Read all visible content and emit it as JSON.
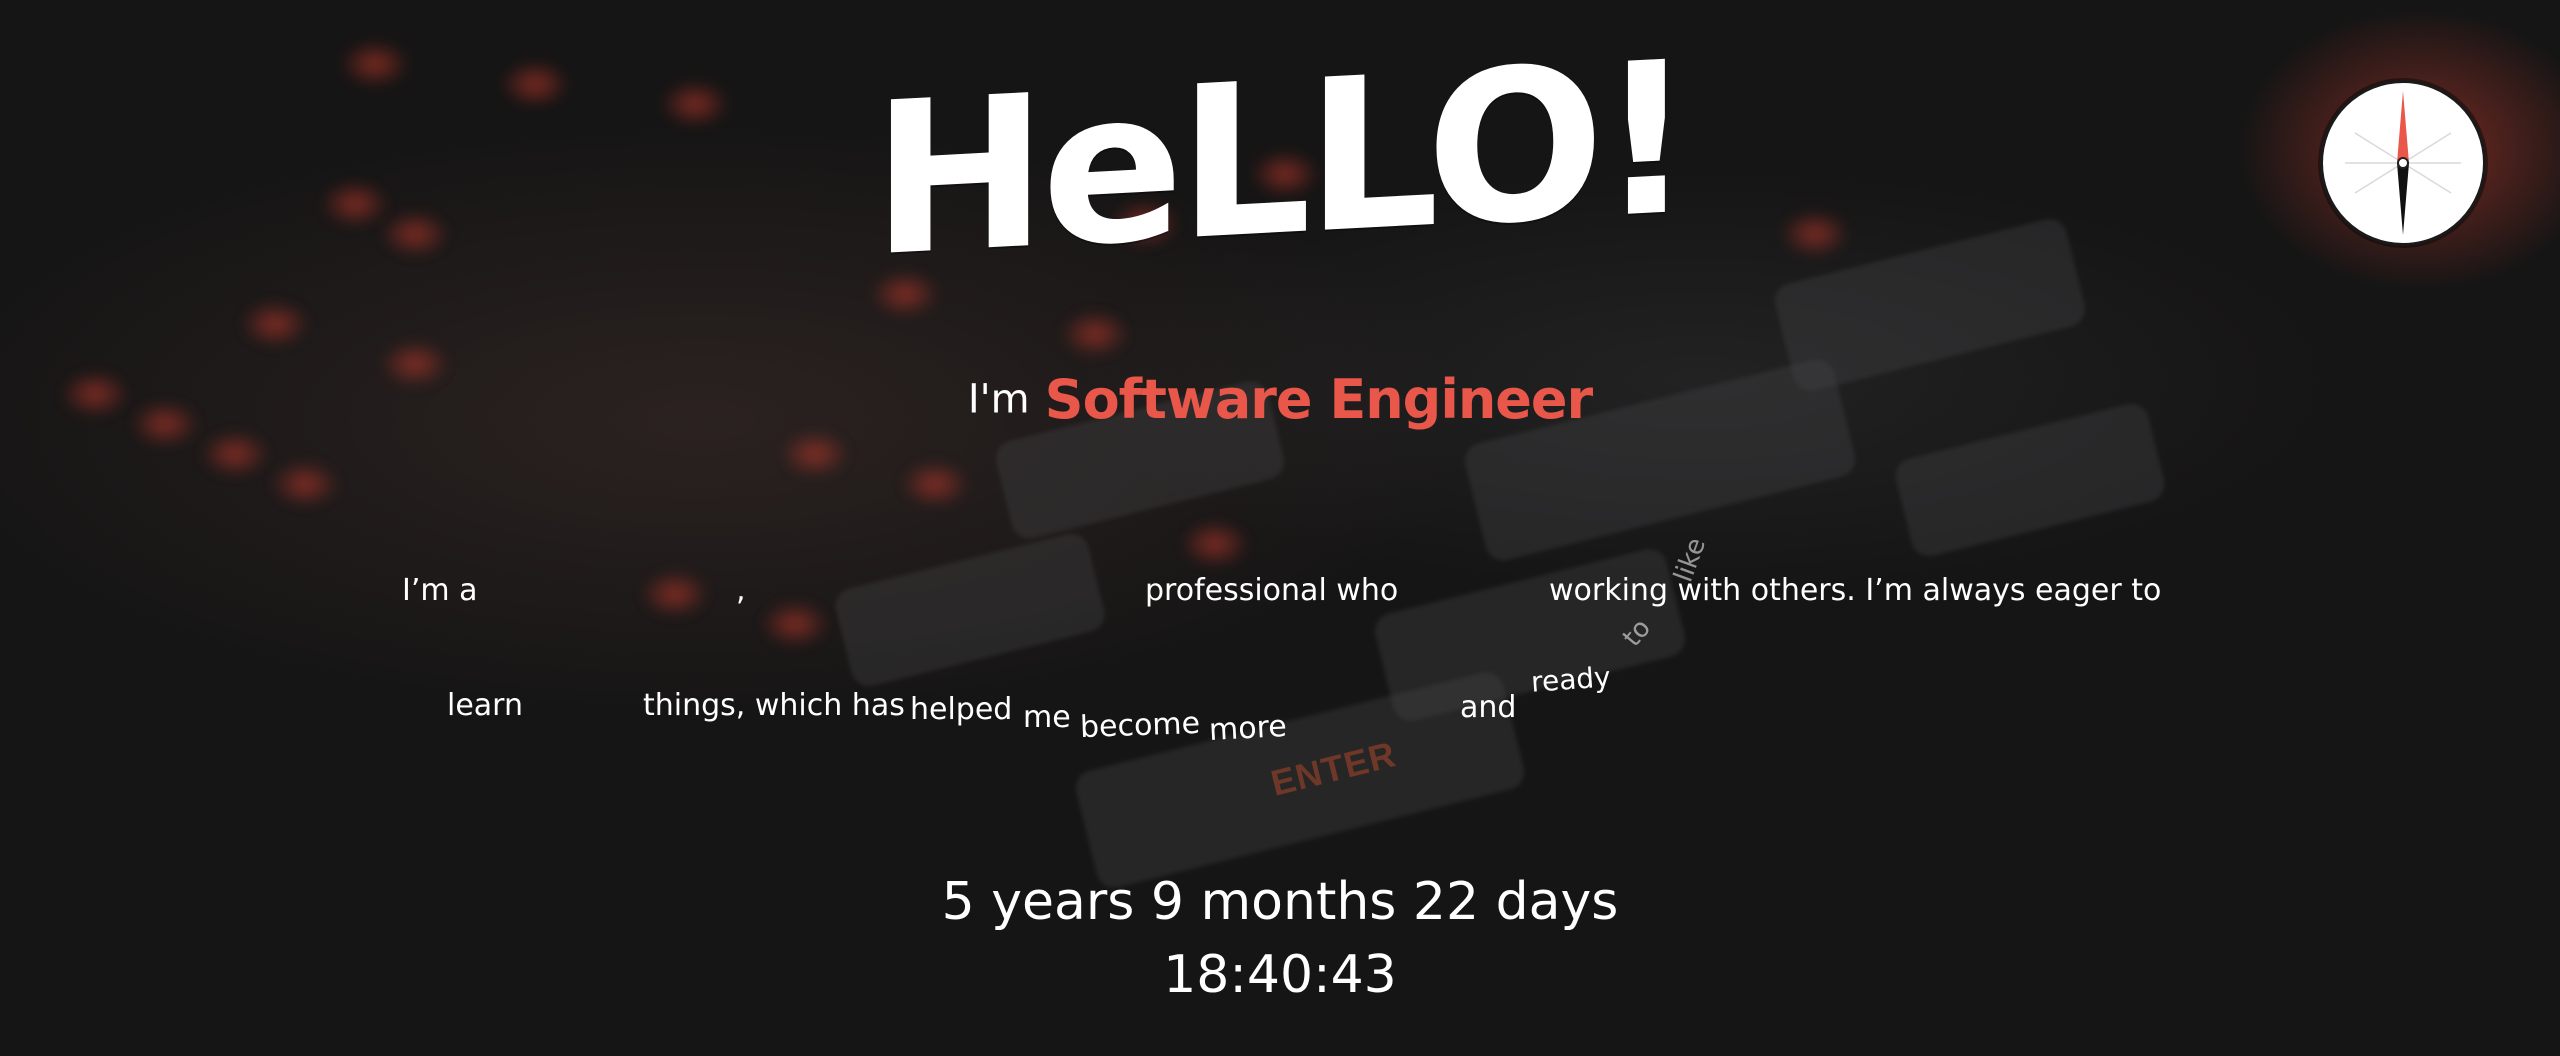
{
  "hero": {
    "title": "HeLLO!",
    "role_prefix": "I'm",
    "role_value": "Software Engineer"
  },
  "bio": {
    "line1": [
      {
        "key": "w1",
        "text": "I’m a"
      },
      {
        "key": "w2",
        "text": ","
      },
      {
        "key": "w3",
        "text": "professional who"
      },
      {
        "key": "w4",
        "text": "working with others. I’m always eager to"
      }
    ],
    "floating": {
      "like": "like",
      "to": "to",
      "ready": "ready"
    },
    "line2": [
      {
        "key": "w5",
        "text": "learn"
      },
      {
        "key": "w6",
        "text": "things, which has"
      },
      {
        "key": "w7",
        "text": "helped"
      },
      {
        "key": "w8",
        "text": "me"
      },
      {
        "key": "w9",
        "text": "become"
      },
      {
        "key": "w10",
        "text": "more"
      },
      {
        "key": "w11",
        "text": "and"
      }
    ]
  },
  "experience_timer": {
    "duration": "5 years 9 months 22 days",
    "clock": "18:40:43"
  },
  "background_keyboard": {
    "key_label": "ENTER"
  },
  "theme": {
    "accent": "#e8574a",
    "background": "#161515",
    "text": "#ffffff"
  },
  "compass": {
    "icon": "compass-icon"
  }
}
